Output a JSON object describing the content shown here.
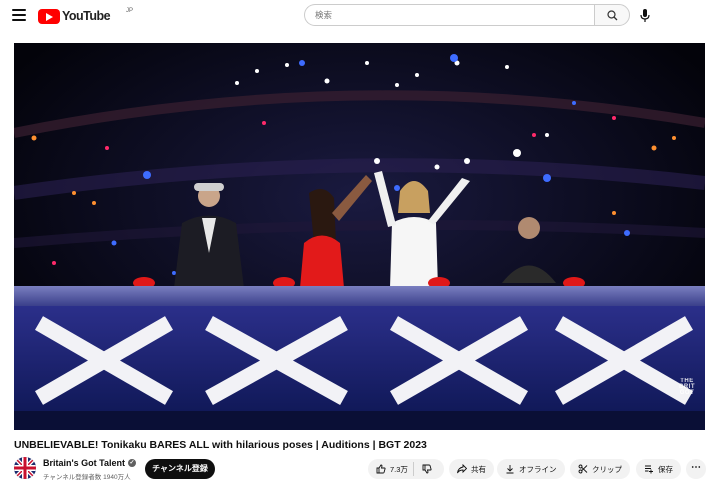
{
  "header": {
    "logo_text": "YouTube",
    "logo_region": "JP",
    "search_placeholder": "検索"
  },
  "video": {
    "title": "UNBELIEVABLE! Tonikaku BARES ALL with hilarious poses | Auditions | BGT 2023",
    "watermark_line1": "THE",
    "watermark_line2": "BRIT",
    "watermark_line3": "GOT"
  },
  "channel": {
    "name": "Britain's Got Talent",
    "subscribers": "チャンネル登録者数 1940万人",
    "subscribe_label": "チャンネル登録"
  },
  "actions": {
    "like_count": "7.3万",
    "share_label": "共有",
    "offline_label": "オフライン",
    "clip_label": "クリップ",
    "save_label": "保存",
    "more_label": "⋯"
  },
  "colors": {
    "brand_red": "#ff0000",
    "subscribe_bg": "#0f0f0f",
    "pill_bg": "#f2f2f2"
  }
}
